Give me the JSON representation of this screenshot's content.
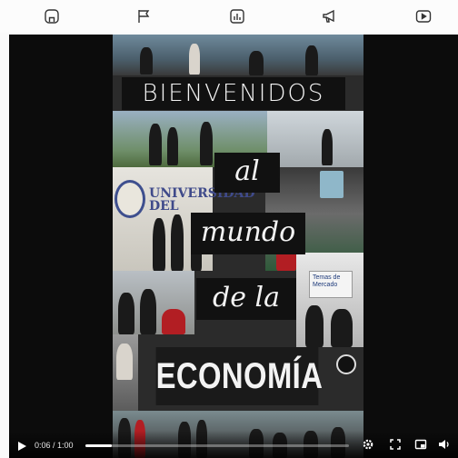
{
  "nav": {
    "items": [
      {
        "icon": "home-icon",
        "label": "Home"
      },
      {
        "icon": "flag-icon",
        "label": "Flag"
      },
      {
        "icon": "chart-icon",
        "label": "Chart"
      },
      {
        "icon": "megaphone-icon",
        "label": "Announce"
      },
      {
        "icon": "video-icon",
        "label": "Video"
      }
    ]
  },
  "video": {
    "title_line1": "BIENVENIDOS",
    "title_line2": "al",
    "title_line3": "mundo",
    "title_line4": "de la",
    "title_line5": "ECONOMÍA",
    "logo_text": "UNIVERSIDAD DEL",
    "sign_text": "Temas de Mercado"
  },
  "player": {
    "time": "0:06 / 1:00",
    "progress": 0.1,
    "controls": [
      "play-icon",
      "settings-icon",
      "fullscreen-icon",
      "pip-icon",
      "volume-icon"
    ]
  },
  "colors": {
    "background": "#0c0c0c",
    "title_box": "#111111",
    "brand_blue": "#3e4f8e",
    "accent_red": "#b21e23"
  }
}
